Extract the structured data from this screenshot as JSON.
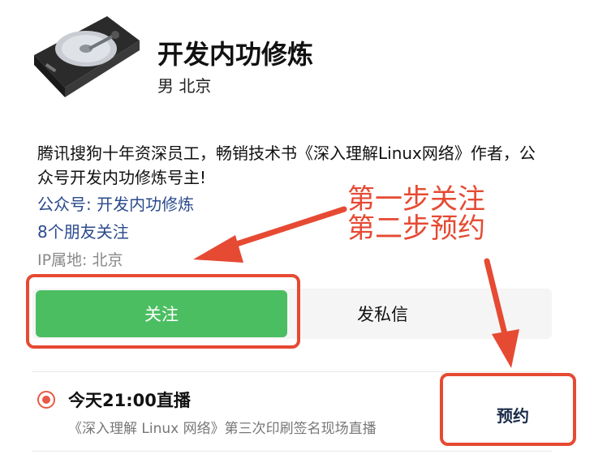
{
  "profile": {
    "name": "开发内功修炼",
    "meta": "男 北京",
    "bio": "腾讯搜狗十年资深员工，畅销技术书《深入理解Linux网络》作者，公众号开发内功修炼号主!",
    "official_account": "公众号: 开发内功修炼",
    "friends_following": "8个朋友关注",
    "ip_location": "IP属地: 北京"
  },
  "actions": {
    "follow_label": "关注",
    "message_label": "发私信"
  },
  "live": {
    "title": "今天21:00直播",
    "description": "《深入理解 Linux 网络》第三次印刷签名现场直播",
    "reserve_label": "预约"
  },
  "annotations": {
    "step1": "第一步关注",
    "step2": "第二步预约",
    "color": "#e64a33"
  },
  "colors": {
    "follow_button": "#4cbe62",
    "link": "#2a4a8c",
    "live_dot": "#e85a45"
  }
}
